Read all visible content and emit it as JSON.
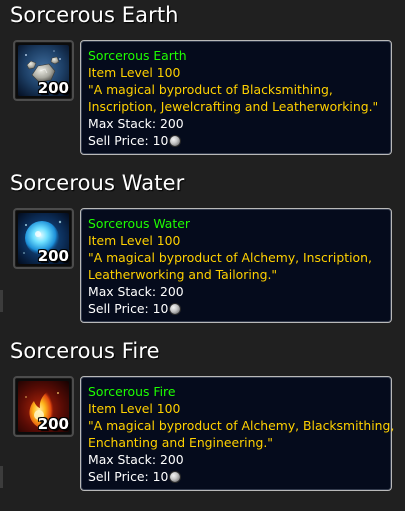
{
  "sections": [
    {
      "title": "Sorcerous Earth",
      "icon": {
        "name": "sorcerous-earth-icon",
        "count": "200",
        "colors": [
          "#2a4f7a",
          "#c9c9c0"
        ]
      },
      "tooltip": {
        "name": "Sorcerous Earth",
        "item_level": "Item Level 100",
        "flavor_lines": [
          "\"A magical byproduct of Blacksmithing,",
          "Inscription, Jewelcrafting and Leatherworking.\""
        ],
        "max_stack": "Max Stack: 200",
        "sell_price": "Sell Price: 10",
        "currency_icon": "silver-coin-icon"
      }
    },
    {
      "title": "Sorcerous Water",
      "icon": {
        "name": "sorcerous-water-icon",
        "count": "200",
        "colors": [
          "#0a2e5c",
          "#4fd0ff"
        ]
      },
      "tooltip": {
        "name": "Sorcerous Water",
        "item_level": "Item Level 100",
        "flavor_lines": [
          "\"A magical byproduct of Alchemy, Inscription,",
          "Leatherworking and Tailoring.\""
        ],
        "max_stack": "Max Stack: 200",
        "sell_price": "Sell Price: 10",
        "currency_icon": "silver-coin-icon"
      }
    },
    {
      "title": "Sorcerous Fire",
      "icon": {
        "name": "sorcerous-fire-icon",
        "count": "200",
        "colors": [
          "#5a0c05",
          "#ffb81c"
        ]
      },
      "tooltip": {
        "name": "Sorcerous Fire",
        "item_level": "Item Level 100",
        "flavor_lines": [
          "\"A magical byproduct of Alchemy, Blacksmithing,",
          "Enchanting and Engineering.\""
        ],
        "max_stack": "Max Stack: 200",
        "sell_price": "Sell Price: 10",
        "currency_icon": "silver-coin-icon"
      }
    }
  ],
  "colors": {
    "background": "#202020",
    "item_name_uncommon": "#1eff00",
    "item_level_and_flavor": "#ffd100",
    "tooltip_background": "#050b1c",
    "tooltip_border": "#b9b9b9"
  }
}
